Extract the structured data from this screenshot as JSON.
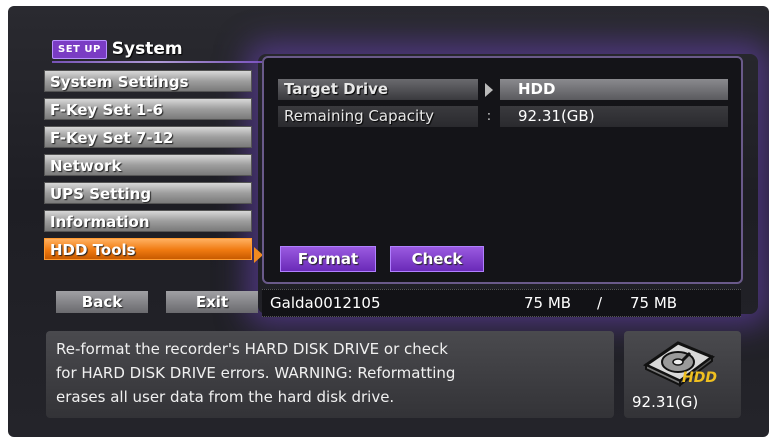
{
  "header": {
    "badge": "SET UP",
    "title": "System"
  },
  "menu": {
    "items": [
      {
        "label": "System Settings",
        "active": false
      },
      {
        "label": "F-Key Set 1-6",
        "active": false
      },
      {
        "label": "F-Key Set 7-12",
        "active": false
      },
      {
        "label": "Network",
        "active": false
      },
      {
        "label": "UPS Setting",
        "active": false
      },
      {
        "label": "Information",
        "active": false
      },
      {
        "label": "HDD Tools",
        "active": true
      }
    ]
  },
  "panel": {
    "target_drive": {
      "label": "Target Drive",
      "value": "HDD"
    },
    "remaining_capacity": {
      "label": "Remaining Capacity",
      "separator": ":",
      "value": "92.31(GB)"
    },
    "format_button": "Format",
    "check_button": "Check"
  },
  "bottom_bar": {
    "back_label": "Back",
    "exit_label": "Exit",
    "device_name": "Galda0012105",
    "used": "75 MB",
    "slash": "/",
    "total": "75 MB"
  },
  "help": {
    "lines": [
      "Re-format the recorder's HARD DISK DRIVE or check",
      "for HARD DISK DRIVE errors. WARNING: Reformatting",
      "erases all user data from the hard disk drive."
    ]
  },
  "hdd_status": {
    "icon": "hdd-icon",
    "label": "HDD",
    "capacity": "92.31(G)"
  },
  "colors": {
    "accent_purple": "#7a3cc4",
    "active_orange": "#f07a10",
    "hdd_yellow": "#f0c020"
  }
}
